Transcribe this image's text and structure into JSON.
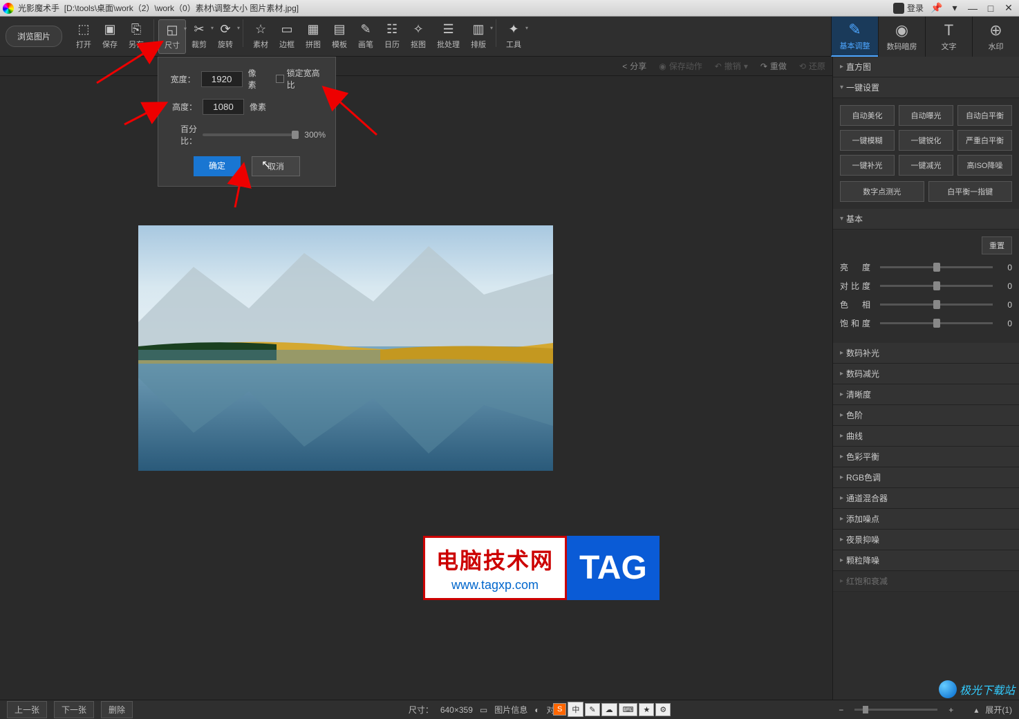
{
  "titlebar": {
    "app_name": "光影魔术手",
    "file_path": "[D:\\tools\\桌面\\work（2）\\work（0）素材\\调整大小 图片素材.jpg]",
    "login": "登录"
  },
  "toolbar": {
    "browse": "浏览图片",
    "items": [
      {
        "label": "打开",
        "icon": "⬚"
      },
      {
        "label": "保存",
        "icon": "▣"
      },
      {
        "label": "另存",
        "icon": "⎘"
      },
      {
        "label": "尺寸",
        "icon": "◱",
        "active": true,
        "dropdown": true
      },
      {
        "label": "裁剪",
        "icon": "✂",
        "dropdown": true
      },
      {
        "label": "旋转",
        "icon": "⟳",
        "dropdown": true
      },
      {
        "label": "素材",
        "icon": "☆"
      },
      {
        "label": "边框",
        "icon": "▭"
      },
      {
        "label": "拼图",
        "icon": "▦"
      },
      {
        "label": "模板",
        "icon": "▤"
      },
      {
        "label": "画笔",
        "icon": "✎"
      },
      {
        "label": "日历",
        "icon": "☷"
      },
      {
        "label": "抠图",
        "icon": "✧"
      },
      {
        "label": "批处理",
        "icon": "☰"
      },
      {
        "label": "排版",
        "icon": "▥",
        "dropdown": true
      },
      {
        "label": "工具",
        "icon": "✦",
        "dropdown": true
      }
    ]
  },
  "right_tabs": [
    {
      "label": "基本调整",
      "icon": "✎",
      "active": true
    },
    {
      "label": "数码暗房",
      "icon": "◉"
    },
    {
      "label": "文字",
      "icon": "T"
    },
    {
      "label": "水印",
      "icon": "⊕"
    }
  ],
  "actionbar": {
    "share": "分享",
    "save_action": "保存动作",
    "undo": "撤销",
    "redo": "重做",
    "restore": "还原"
  },
  "popup": {
    "width_label": "宽度：",
    "width_value": "1920",
    "height_label": "高度：",
    "height_value": "1080",
    "unit": "像素",
    "lock_ratio": "锁定宽高比",
    "percent_label": "百分比：",
    "percent_value": "300%",
    "ok": "确定",
    "cancel": "取消"
  },
  "rightpanel": {
    "sections": {
      "histogram": "直方图",
      "one_click": "一键设置",
      "basic": "基本",
      "digital_fill": "数码补光",
      "digital_dim": "数码减光",
      "clarity": "清晰度",
      "levels": "色阶",
      "curves": "曲线",
      "color_balance": "色彩平衡",
      "rgb": "RGB色调",
      "channel_mixer": "通道混合器",
      "add_noise": "添加噪点",
      "night_denoise": "夜景抑噪",
      "grain_denoise": "颗粒降噪",
      "last": "红饱和衰减"
    },
    "presets": [
      "自动美化",
      "自动曝光",
      "自动白平衡",
      "一键模糊",
      "一键锐化",
      "严重白平衡",
      "一键补光",
      "一键减光",
      "高ISO降噪"
    ],
    "presets2": [
      "数字点测光",
      "白平衡一指键"
    ],
    "reset": "重置",
    "sliders": [
      {
        "label": "亮　度",
        "value": "0"
      },
      {
        "label": "对比度",
        "value": "0"
      },
      {
        "label": "色　相",
        "value": "0"
      },
      {
        "label": "饱和度",
        "value": "0"
      }
    ]
  },
  "bottombar": {
    "prev": "上一张",
    "next": "下一张",
    "delete": "删除",
    "size_label": "尺寸：",
    "size_value": "640×359",
    "img_info": "图片信息",
    "compare": "对比",
    "expand": "展开(1)"
  },
  "ime": {
    "s": "S",
    "zhong": "中",
    "items": [
      "✎",
      "☁",
      "⌨",
      "★",
      "⚙"
    ]
  },
  "watermark": {
    "l1": "电脑技术网",
    "l2": "www.tagxp.com",
    "tag": "TAG"
  },
  "dl_wm": "极光下载站"
}
